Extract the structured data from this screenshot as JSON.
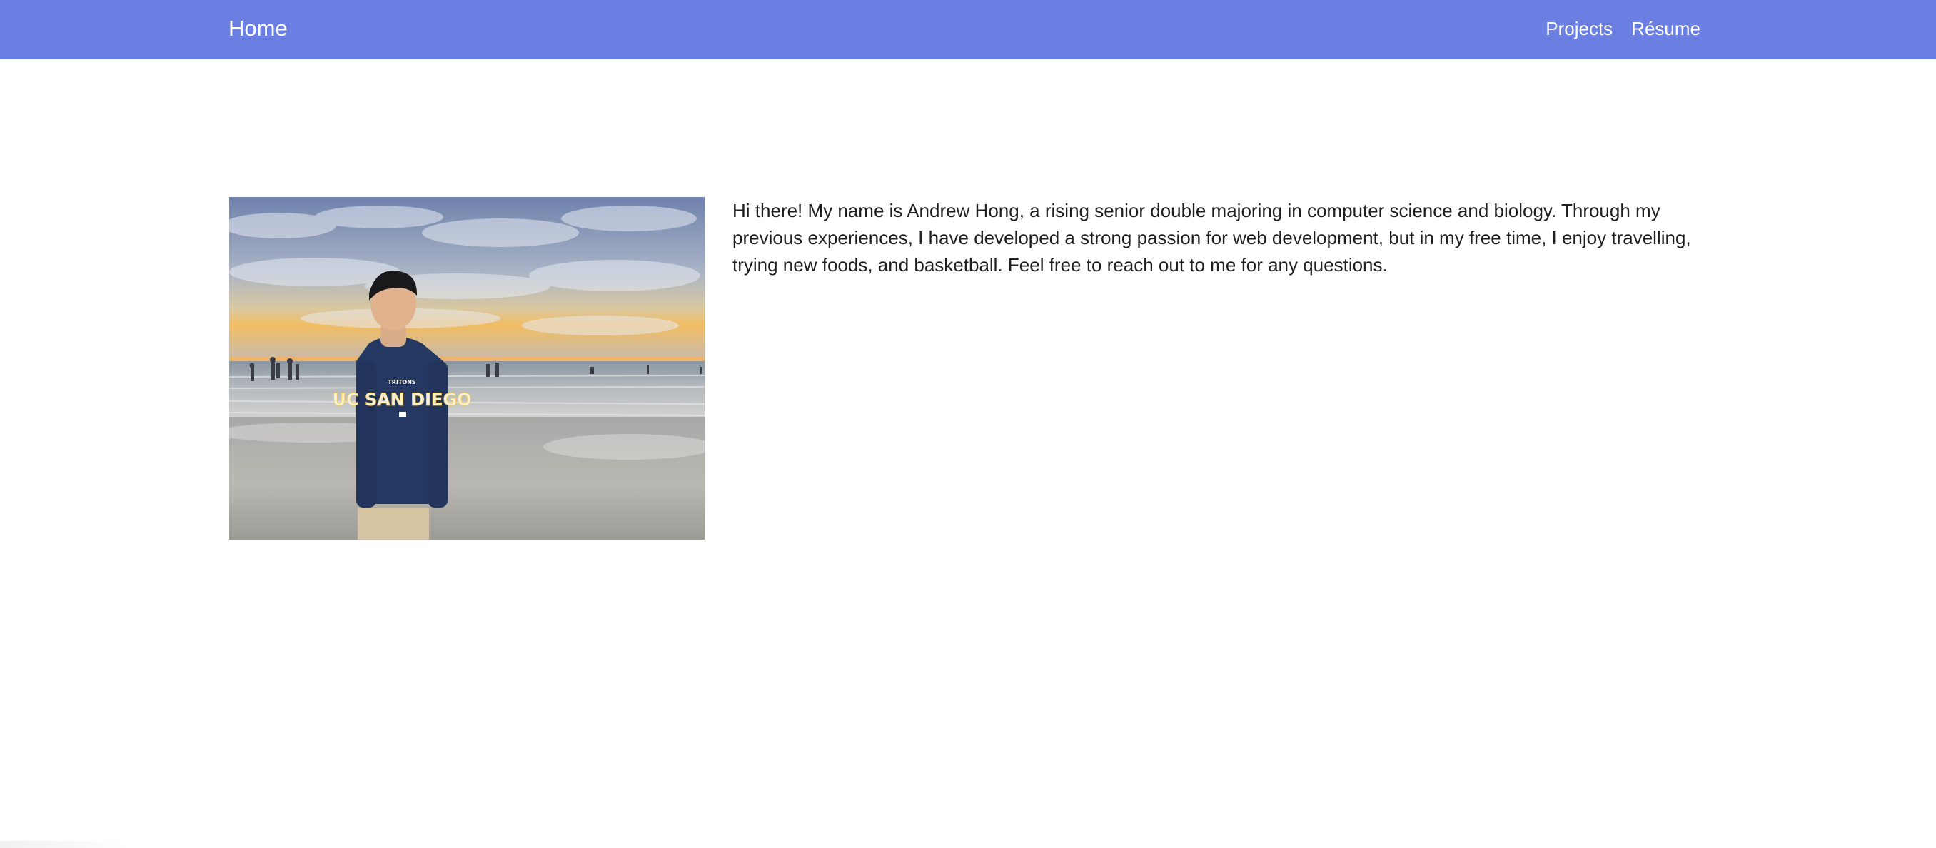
{
  "nav": {
    "brand": "Home",
    "links": [
      {
        "label": "Projects"
      },
      {
        "label": "Résume"
      }
    ]
  },
  "profile": {
    "bio": "Hi there! My name is Andrew Hong, a rising senior double majoring in computer science and biology. Through my previous experiences, I have developed a strong passion for web development, but in my free time, I enjoy travelling, trying new foods, and basketball. Feel free to reach out to me for any questions.",
    "photo_alt": "Portrait on beach at sunset",
    "sweatshirt_text": "UC SAN DIEGO",
    "sweatshirt_small_text": "TRITONS"
  },
  "colors": {
    "navbar": "#6b7ee2",
    "nav_text": "#ffffff",
    "body_text": "#1f1f1f",
    "background": "#ffffff"
  }
}
